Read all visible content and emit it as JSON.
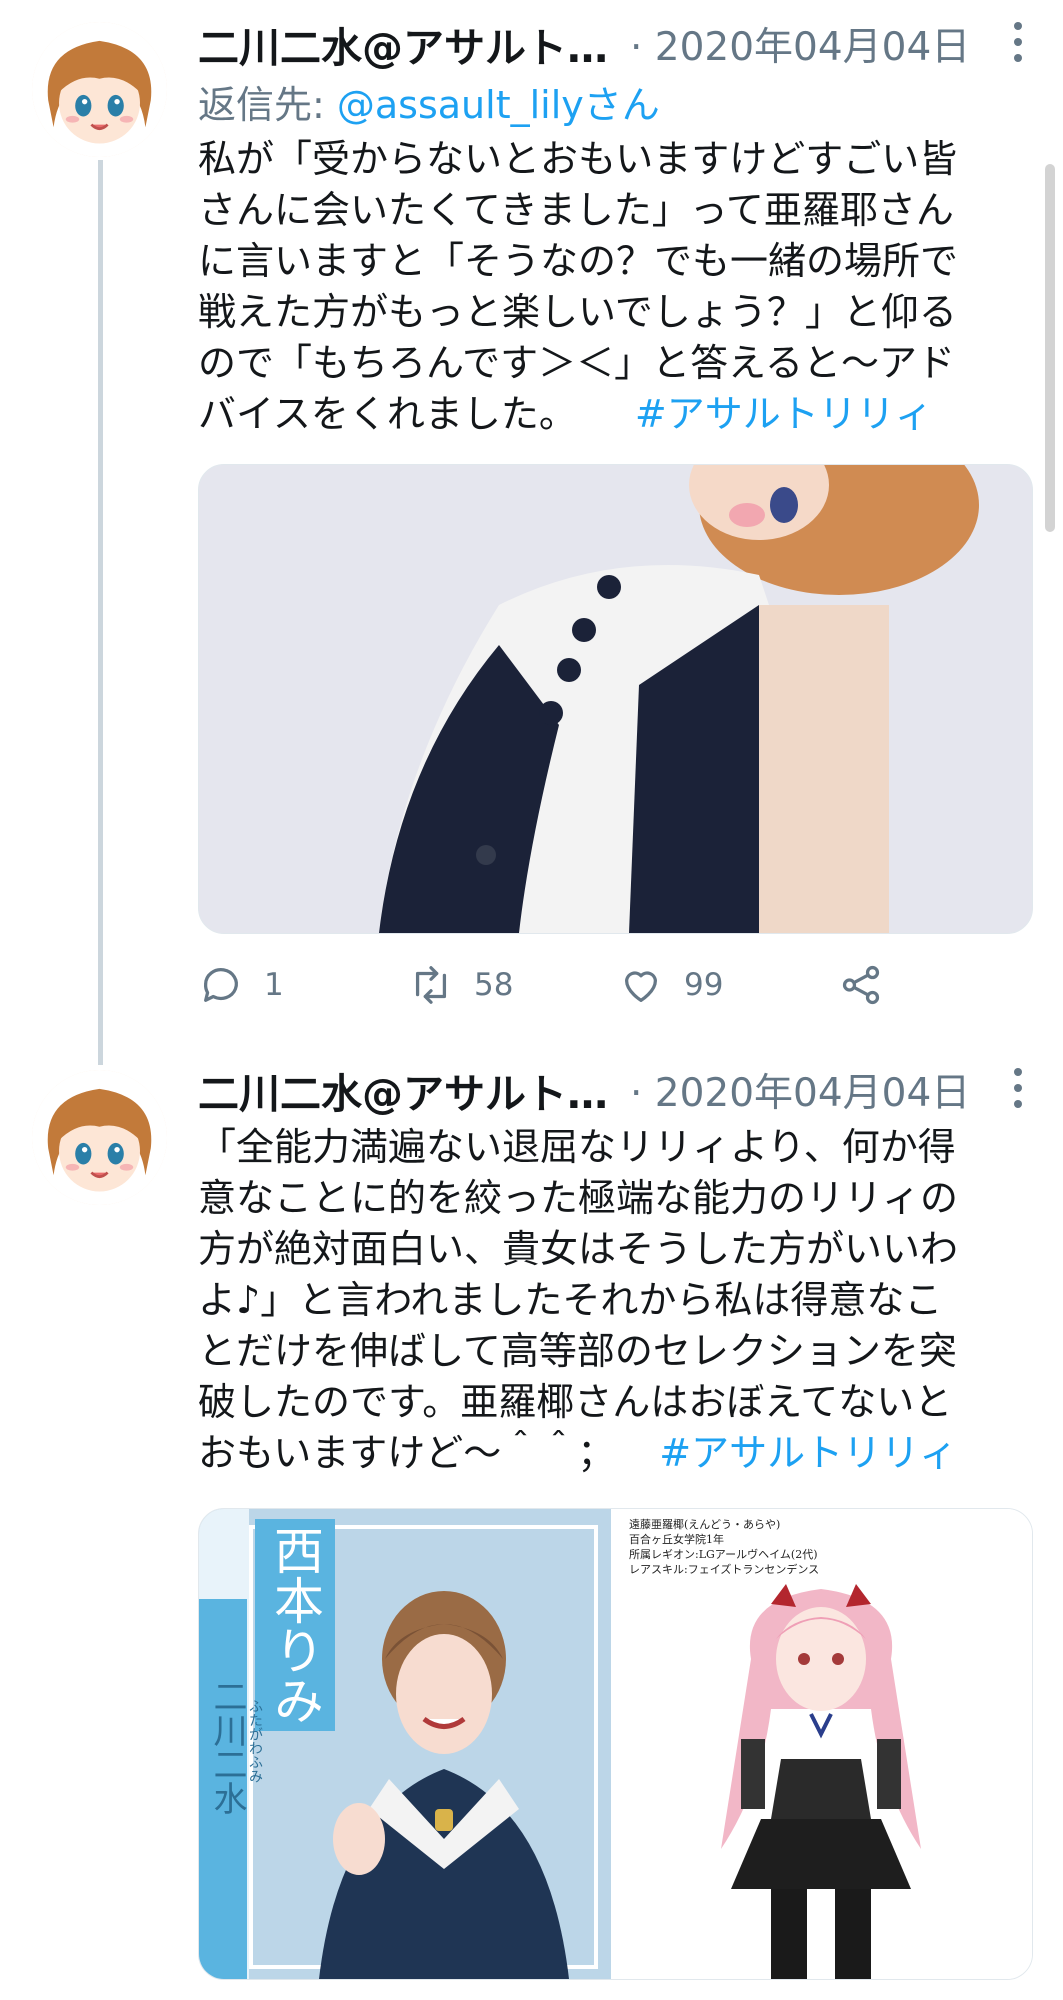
{
  "tweets": [
    {
      "author_name": "二川二水@アサルト…",
      "date": "· 2020年04月04日",
      "reply_label": "返信先: ",
      "reply_mention": "@assault_lilyさん",
      "body_lines": [
        "私が「受からないとおもいますけどすごい皆",
        "さんに会いたくてきました」って亜羅耶さん",
        "に言いますと「そうなの？でも一緒の場所で",
        "戦えた方がもっと楽しいでしょう？」と仰る",
        "ので「もちろんです＞＜」と答えると～アド",
        "バイスをくれました。"
      ],
      "hashtag": "#アサルトリリィ",
      "actions": {
        "reply_count": "1",
        "retweet_count": "58",
        "like_count": "99"
      }
    },
    {
      "author_name": "二川二水@アサルト…",
      "date": "· 2020年04月04日",
      "body_lines": [
        "「全能力満遍ない退屈なリリィより、何か得",
        "意なことに的を絞った極端な能力のリリィの",
        "方が絶対面白い、貴女はそうした方がいいわ",
        "よ♪」と言われましたそれから私は得意なこ",
        "とだけを伸ばして高等部のセレクションを突",
        "破したのです。亜羅椰さんはおぼえてないと",
        "おもいますけど～＾＾；"
      ],
      "hashtag": "#アサルトリリィ",
      "media_left": {
        "vertical_name": "西本りみ",
        "vertical_role": "二川二水",
        "ruby": "ふたがわふみ"
      },
      "media_right": {
        "caption_lines": [
          "遠藤亜羅椰(えんどう・あらや)",
          "百合ヶ丘女学院1年",
          "所属レギオン:LGアールヴヘイム(2代)",
          "レアスキル:フェイズトランセンデンス"
        ]
      }
    }
  ],
  "icons": {
    "reply": "comment-icon",
    "retweet": "retweet-icon",
    "like": "heart-icon",
    "share": "share-icon",
    "more": "more-vertical-icon"
  },
  "colors": {
    "link": "#1da1f2",
    "muted": "#657786",
    "text": "#14171a"
  }
}
